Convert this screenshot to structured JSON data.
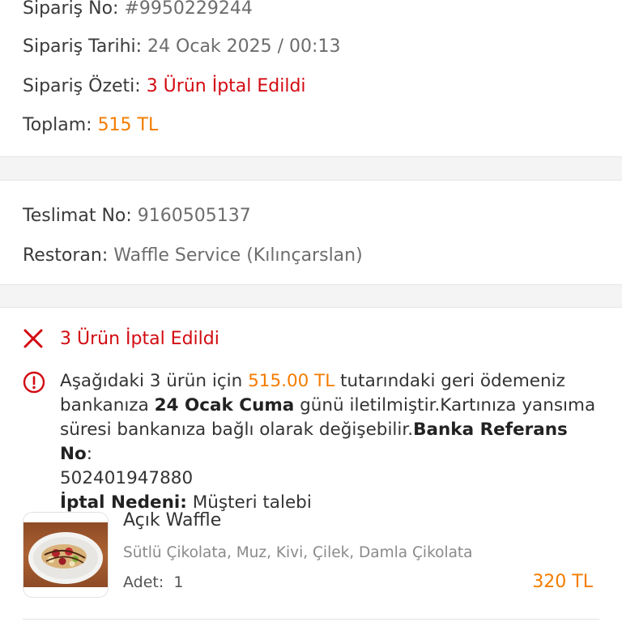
{
  "order": {
    "no_label": "Sipariş No:",
    "no_value": "#9950229244",
    "date_label": "Sipariş Tarihi:",
    "date_value": "24 Ocak 2025 / 00:13",
    "summary_label": "Sipariş Özeti:",
    "summary_value": "3 Ürün İptal Edildi",
    "total_label": "Toplam:",
    "total_value": "515 TL"
  },
  "delivery": {
    "no_label": "Teslimat No:",
    "no_value": "9160505137",
    "restaurant_label": "Restoran:",
    "restaurant_value": "Waffle Service (Kılınçarslan)"
  },
  "cancellation": {
    "title": "3 Ürün İptal Edildi",
    "text_1": "Aşağıdaki 3 ürün için ",
    "amount": "515.00 TL",
    "text_2": " tutarındaki geri ödemeniz bankanıza ",
    "date_bold": "24 Ocak Cuma",
    "text_3": " günü iletilmiştir.Kartınıza yansıma süresi bankanıza bağlı olarak değişebilir.",
    "ref_label": "Banka Referans No",
    "ref_colon": ":",
    "ref_value": "502401947880",
    "reason_label": "İptal Nedeni:",
    "reason_value": " Müşteri talebi"
  },
  "product": {
    "name": "Açık Waffle",
    "description": "Sütlü Çikolata, Muz, Kivi, Çilek, Damla Çikolata",
    "qty_label": "Adet:",
    "qty_value": "1",
    "price": "320 TL",
    "image_icon": "waffle-photo"
  },
  "colors": {
    "red": "#d20a11",
    "orange": "#f57c00",
    "gap": "#f4f4f4"
  }
}
